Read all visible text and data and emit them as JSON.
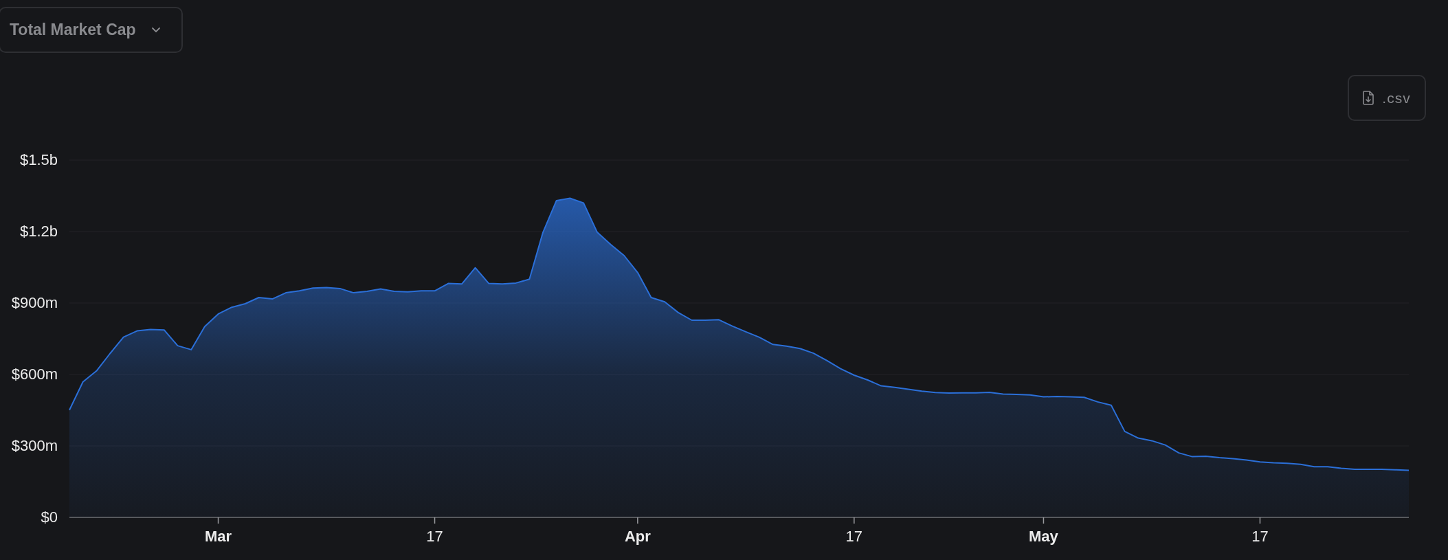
{
  "metric_dropdown": {
    "label": "Total Market Cap"
  },
  "csv_button": {
    "label": ".csv"
  },
  "chart": {
    "chart_data": {
      "type": "area",
      "x": [
        "--02-19",
        "--02-20",
        "--02-21",
        "--02-22",
        "--02-23",
        "--02-24",
        "--02-25",
        "--02-26",
        "--02-27",
        "--02-28",
        "--02-29",
        "--03-01",
        "--03-02",
        "--03-03",
        "--03-04",
        "--03-05",
        "--03-06",
        "--03-07",
        "--03-08",
        "--03-09",
        "--03-10",
        "--03-11",
        "--03-12",
        "--03-13",
        "--03-14",
        "--03-15",
        "--03-16",
        "--03-17",
        "--03-18",
        "--03-19",
        "--03-20",
        "--03-21",
        "--03-22",
        "--03-23",
        "--03-24",
        "--03-25",
        "--03-26",
        "--03-27",
        "--03-28",
        "--03-29",
        "--03-30",
        "--03-31",
        "--04-01",
        "--04-02",
        "--04-03",
        "--04-04",
        "--04-05",
        "--04-06",
        "--04-07",
        "--04-08",
        "--04-09",
        "--04-10",
        "--04-11",
        "--04-12",
        "--04-13",
        "--04-14",
        "--04-15",
        "--04-16",
        "--04-17",
        "--04-18",
        "--04-19",
        "--04-20",
        "--04-21",
        "--04-22",
        "--04-23",
        "--04-24",
        "--04-25",
        "--04-26",
        "--04-27",
        "--04-28",
        "--04-29",
        "--04-30",
        "--05-01",
        "--05-02",
        "--05-03",
        "--05-04",
        "--05-05",
        "--05-06",
        "--05-07",
        "--05-08",
        "--05-09",
        "--05-10",
        "--05-11",
        "--05-12",
        "--05-13",
        "--05-14",
        "--05-15",
        "--05-16",
        "--05-17",
        "--05-18",
        "--05-19",
        "--05-20",
        "--05-21",
        "--05-22",
        "--05-23",
        "--05-24",
        "--05-25",
        "--05-26",
        "--05-27",
        "--05-28"
      ],
      "series": [
        {
          "color": "#2b6fd8",
          "values": [
            451000000,
            569000000,
            615000000,
            688000000,
            757000000,
            783000000,
            789000000,
            787000000,
            721000000,
            704000000,
            801000000,
            854000000,
            882000000,
            897000000,
            923000000,
            917000000,
            943000000,
            951000000,
            963000000,
            965000000,
            961000000,
            943000000,
            949000000,
            959000000,
            949000000,
            947000000,
            951000000,
            951000000,
            982000000,
            980000000,
            1048000000,
            982000000,
            980000000,
            984000000,
            1000000000,
            1196000000,
            1330000000,
            1340000000,
            1320000000,
            1198000000,
            1146000000,
            1099000000,
            1028000000,
            923000000,
            905000000,
            860000000,
            828000000,
            828000000,
            830000000,
            803000000,
            779000000,
            756000000,
            726000000,
            719000000,
            709000000,
            689000000,
            658000000,
            624000000,
            597000000,
            577000000,
            552000000,
            546000000,
            538000000,
            530000000,
            524000000,
            522000000,
            523000000,
            523000000,
            525000000,
            518000000,
            516000000,
            514000000,
            506000000,
            508000000,
            506000000,
            504000000,
            485000000,
            471000000,
            361000000,
            333000000,
            322000000,
            304000000,
            271000000,
            255000000,
            257000000,
            251000000,
            247000000,
            241000000,
            233000000,
            229000000,
            227000000,
            223000000,
            213000000,
            213000000,
            206000000,
            202000000,
            202000000,
            202000000,
            200000000,
            198000000
          ]
        }
      ],
      "xlim": [
        "--02-19",
        "--05-28"
      ],
      "grid": true,
      "ylim": [
        0,
        1500000000
      ],
      "xticks": [
        {
          "value": "--03-01",
          "label": "Mar"
        },
        {
          "value": "--03-17",
          "label": "17"
        },
        {
          "value": "--04-01",
          "label": "Apr"
        },
        {
          "value": "--04-17",
          "label": "17"
        },
        {
          "value": "--05-01",
          "label": "May"
        },
        {
          "value": "--05-17",
          "label": "17"
        }
      ],
      "yticks": [
        {
          "value": 0,
          "label": "$0"
        },
        {
          "value": 300000000,
          "label": "$300m"
        },
        {
          "value": 600000000,
          "label": "$600m"
        },
        {
          "value": 900000000,
          "label": "$900m"
        },
        {
          "value": 1200000000,
          "label": "$1.2b"
        },
        {
          "value": 1500000000,
          "label": "$1.5b"
        }
      ]
    }
  }
}
